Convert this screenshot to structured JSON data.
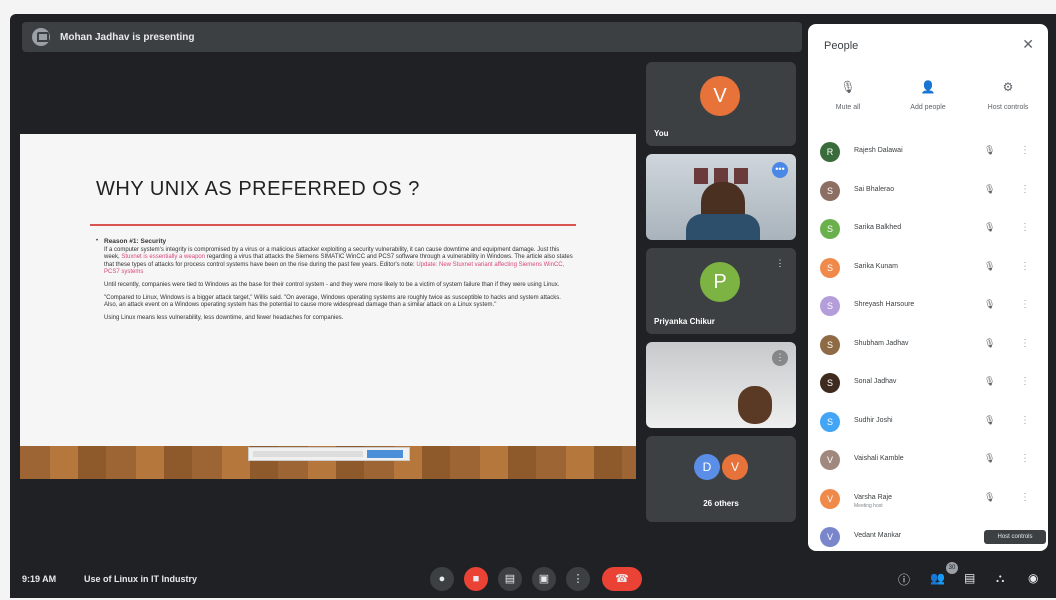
{
  "banner": {
    "text": "Mohan Jadhav is presenting"
  },
  "slide": {
    "title": "WHY UNIX AS PREFERRED OS ?",
    "heading": "Reason #1: Security",
    "para1": "If a computer system's integrity is compromised by a virus or a malicious attacker exploiting a security vulnerability, it can cause downtime and equipment damage. Just this week,",
    "para1_link": "Stuxnet is essentially a weapon",
    "para1b": "regarding a virus that attacks the Siemens SIMATIC WinCC and PCS7 software through a vulnerability in Windows. The article also states that these types of attacks for process control systems have been on the rise during the past few years. Editor's note:",
    "para1_link2": "Update: New Stuxnet variant affecting Siemens WinCC, PCS7 systems",
    "para2": "Until recently, companies were tied to Windows as the base for their control system - and they were more likely to be a victim of system failure than if they were using Linux.",
    "para3": "\"Compared to Linux, Windows is a bigger attack target,\" Willis said. \"On average, Windows operating systems are roughly twice as susceptible to hacks and system attacks. Also, an attack event on a Windows operating system has the potential to cause more widespread damage than a similar attack on a Linux system.\"",
    "para4": "Using Linux means less vulnerability, less downtime, and fewer headaches for companies."
  },
  "tiles": {
    "you": {
      "initial": "V",
      "label": "You",
      "color": "#e8733a"
    },
    "priyanka": {
      "initial": "P",
      "label": "Priyanka Chikur",
      "color": "#7cb342"
    },
    "others": {
      "initial1": "D",
      "initial2": "V",
      "label": "26 others",
      "color1": "#5b8ee6",
      "color2": "#e8733a"
    }
  },
  "bottom": {
    "time": "9:19 AM",
    "meeting": "Use of Linux in IT Industry",
    "people_count": "30",
    "tooltip": "Host controls"
  },
  "panel": {
    "title": "People",
    "actions": [
      {
        "label": "Mute all",
        "icon": "mic-off-icon",
        "glyph": "🎙"
      },
      {
        "label": "Add people",
        "icon": "add-person-icon",
        "glyph": "👤"
      },
      {
        "label": "Host controls",
        "icon": "host-controls-icon",
        "glyph": "⚙"
      }
    ],
    "people": [
      {
        "name": "Rajesh Dalawai",
        "initial": "R",
        "color": "#3a6b3a",
        "sub": ""
      },
      {
        "name": "Sai Bhalerao",
        "initial": "S",
        "color": "#8d6e63",
        "sub": ""
      },
      {
        "name": "Sarika Balkhed",
        "initial": "S",
        "color": "#6ab04c",
        "sub": ""
      },
      {
        "name": "Sarika Kunam",
        "initial": "S",
        "color": "#f08a4b",
        "sub": ""
      },
      {
        "name": "Shreyash Harsoure",
        "initial": "S",
        "color": "#b39ddb",
        "sub": ""
      },
      {
        "name": "Shubham Jadhav",
        "initial": "S",
        "color": "#8e6b45",
        "sub": ""
      },
      {
        "name": "Sonal Jadhav",
        "initial": "S",
        "color": "#3e2a1e",
        "sub": ""
      },
      {
        "name": "Sudhir Joshi",
        "initial": "S",
        "color": "#42a5f5",
        "sub": ""
      },
      {
        "name": "Vaishali Kamble",
        "initial": "V",
        "color": "#a1887f",
        "sub": ""
      },
      {
        "name": "Varsha Raje",
        "initial": "V",
        "color": "#f08a4b",
        "sub": "Meeting host"
      },
      {
        "name": "Vedant Mankar",
        "initial": "V",
        "color": "#7986cb",
        "sub": ""
      }
    ]
  }
}
